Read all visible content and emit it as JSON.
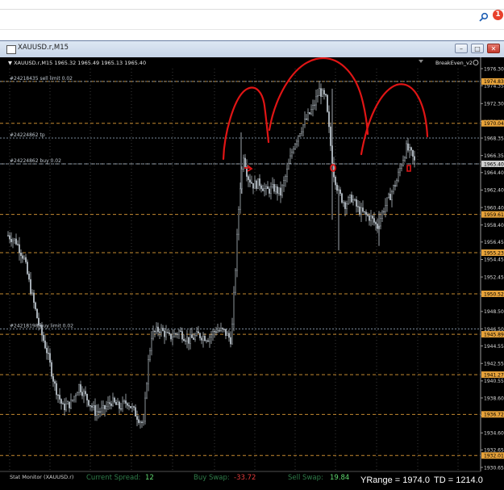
{
  "toolbar": {
    "search_icon": "search-icon",
    "alert_count": "1",
    "alert_color": "#e8412c"
  },
  "window": {
    "title": "XAUUSD.r,M15",
    "buttons": [
      "minimize",
      "maximize",
      "close"
    ]
  },
  "chart": {
    "header": "▼ XAUUSD.r,M15  1965.32 1965.49 1965.13 1965.40",
    "indicator": "BreakEven_v2",
    "background": "#000000",
    "candle_color": "#b0b8c0"
  },
  "orders": [
    {
      "label": "#24218435 sell limit 0.02",
      "price": 1974.83
    },
    {
      "label": "#24224862 tp",
      "price": 1968.35
    },
    {
      "label": "#24224862 buy 0.02",
      "price": 1965.4
    },
    {
      "label": "#24218198 buy limit 0.02",
      "price": 1946.5
    }
  ],
  "price_axis": {
    "ticks": [
      "1976.30",
      "1974.35",
      "1972.30",
      "1970.25",
      "1968.35",
      "1966.35",
      "1964.40",
      "1962.40",
      "1960.40",
      "1958.40",
      "1956.45",
      "1954.45",
      "1952.45",
      "1950.45",
      "1948.50",
      "1946.50",
      "1944.55",
      "1942.55",
      "1940.55",
      "1938.60",
      "1936.60",
      "1934.60",
      "1932.65",
      "1930.65"
    ],
    "highlighted": [
      {
        "value": "1974.83",
        "color": "#e8a33a"
      },
      {
        "value": "1970.04",
        "color": "#e8a33a"
      },
      {
        "value": "1965.40",
        "color": "#d0d0d0"
      },
      {
        "value": "1959.61",
        "color": "#e8a33a"
      },
      {
        "value": "1955.23",
        "color": "#e8a33a"
      },
      {
        "value": "1950.52",
        "color": "#e8a33a"
      },
      {
        "value": "1945.89",
        "color": "#e8a33a"
      },
      {
        "value": "1941.27",
        "color": "#e8a33a"
      },
      {
        "value": "1936.72",
        "color": "#e8a33a"
      },
      {
        "value": "1932.01",
        "color": "#e8a33a"
      }
    ]
  },
  "status": {
    "monitor_label": "Stat Monitor (XAUUSD.r)",
    "spread_label": "Current Spread:",
    "spread_value": "12",
    "buy_swap_label": "Buy Swap:",
    "buy_swap_value": "-33.72",
    "sell_swap_label": "Sell Swap:",
    "sell_swap_value": "19.84",
    "yrange_label": "YRange = 1974.0",
    "td_label": "TD = 1214.0"
  },
  "annotation_color": "#e01515"
}
